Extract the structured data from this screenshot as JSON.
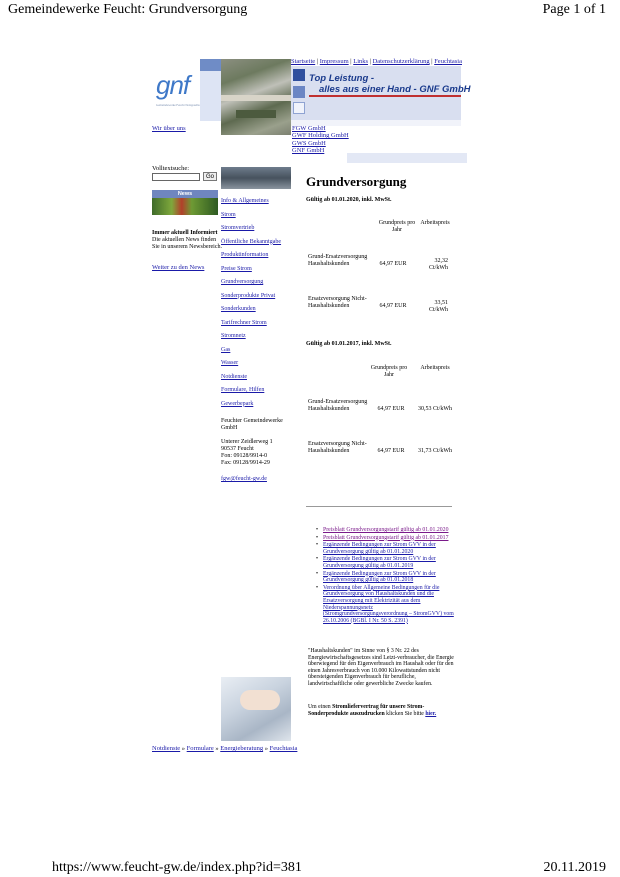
{
  "print": {
    "title": "Gemeindewerke Feucht: Grundversorgung",
    "page": "Page 1 of 1",
    "url": "https://www.feucht-gw.de/index.php?id=381",
    "date": "20.11.2019"
  },
  "logo": {
    "text": "gnf",
    "sub": "Gemeindewerke Feucht Netzgesellschaft"
  },
  "top_nav": [
    "Startseite",
    "Impressum",
    "Links",
    "Datenschutzerklärung",
    "Feuchtasia"
  ],
  "banner": {
    "line1": "Top Leistung -",
    "line2": "alles aus einer Hand - GNF GmbH"
  },
  "wir_ueber_uns": "Wir über uns",
  "companies": [
    "FGW GmbH",
    "GWF Holding GmbH",
    "GWS GmbH",
    "GNF GmbH"
  ],
  "search": {
    "label": "Volltextsuche:",
    "button": "Go"
  },
  "news": {
    "heading": "News",
    "title": "Immer aktuell Informiert",
    "body": "Die aktuellen News finden Sie in unserem Newsbereich.",
    "more": "Weiter zu den News"
  },
  "nav": [
    "Info & Allgemeines",
    "Strom",
    "Stromvertrieb",
    "Öffentliche Bekanntgabe",
    "Produktinformation",
    "Preise Strom",
    "Grundversorgung",
    "Sonderprodukte Privat",
    "Sonderkunden",
    "Tarifrechner Strom",
    "Stromnetz",
    "Gas",
    "Wasser",
    "Notdienste",
    "Formulare, Hilfen",
    "Gewerbepark"
  ],
  "address": {
    "company": "Feuchter Gemeindewerke GmbH",
    "street": "Unterer Zeidlerweg 1",
    "city": "90537 Feucht",
    "phone": "Fon: 09128/9914-0",
    "fax": "Fax: 09128/9914-29",
    "email": "fgw@feucht-gw.de"
  },
  "main": {
    "heading": "Grundversorgung",
    "tables": [
      {
        "valid": "Gültig ab 01.01.2020, inkl. MwSt.",
        "col_grund": "Grundpreis pro Jahr",
        "col_arbeit": "Arbeitspreis",
        "rows": [
          {
            "label": "Grund-Ersatzversorgung Haushaltskunden",
            "grund": "64,97 EUR",
            "arbeit": "32,32 Ct/kWh"
          },
          {
            "label": "Ersatzversorgung Nicht-Haushaltskunden",
            "grund": "64,97 EUR",
            "arbeit": "33,51 Ct/kWh"
          }
        ]
      },
      {
        "valid": "Gültig ab 01.01.2017, inkl. MwSt.",
        "col_grund": "Grundpreis pro Jahr",
        "col_arbeit": "Arbeitspreis",
        "rows": [
          {
            "label": "Grund-Ersatzversorgung Haushaltskunden",
            "grund": "64,97 EUR",
            "arbeit": "30,53 Ct/kWh"
          },
          {
            "label": "Ersatzversorgung Nicht-Haushaltskunden",
            "grund": "64,97 EUR",
            "arbeit": "31,73 Ct/kWh"
          }
        ]
      }
    ],
    "documents": [
      "Preisblatt Grundversorgungstarif gültig ab 01.01.2020",
      "Preisblatt Grundversorgungstarif gültig ab 01.01.2017",
      "Ergänzende Bedingungen zur Strom GVV in der Grundversorgung gültig ab 01.01.2020",
      "Ergänzende Bedingungen zur Strom GVV in der Grundversorgung gültig ab 01.01.2019",
      "Ergänzende Bedingungen zur Strom GVV in der Grundversorgung gültig ab 01.01.2018",
      "Verordnung über Allgemeine Bedingungen für die Grundversorgung von Haushaltskunden und die Ersatzversorgung mit Elektrizität aus dem Niederspannungsnetz (Stromgrundversorgungsverordnung – StromGVV) vom 26.10.2006 (BGBl. I Nr. 50 S. 2391)"
    ],
    "haushalt_text": "\"Haushaltskunden\" im Sinne von § 3 Nr. 22 des Energiewirtschaftsgesetzes sind Letzt-verbraucher, die Energie überwiegend für den Eigenverbrauch im Haushalt oder für den einen Jahresverbrauch von 10.000 Kilowattstunden nicht übersteigenden Eigenverbrauch für berufliche, landwirtschaftliche oder gewerbliche Zwecke kaufen.",
    "strom_pre": "Um einen ",
    "strom_bold": "Stromliefervertrag für unsere Strom-Sonderprodukte auszudrucken",
    "strom_mid": " klicken Sie bitte ",
    "strom_link": "hier."
  },
  "bottom_nav": [
    "Notdienste",
    "Formulare",
    "Energieberatung",
    "Feuchtasia"
  ]
}
